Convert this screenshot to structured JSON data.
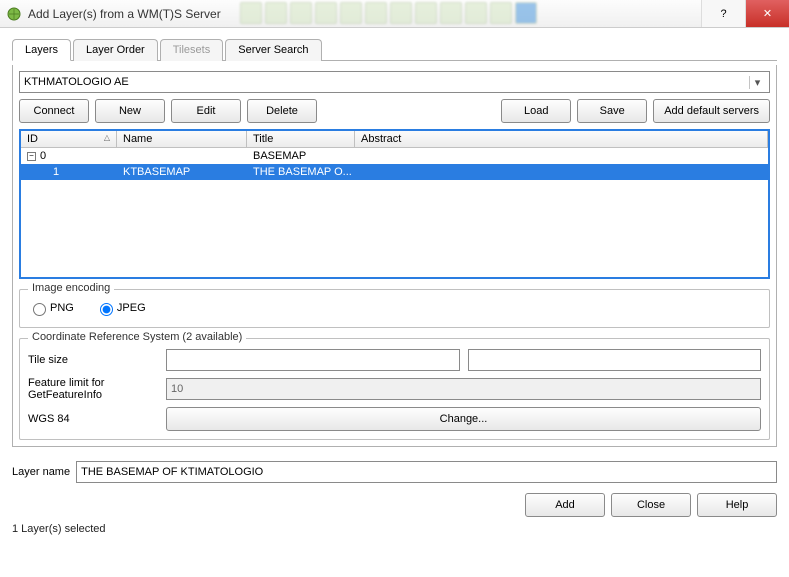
{
  "window": {
    "title": "Add Layer(s) from a WM(T)S Server"
  },
  "tabs": {
    "items": [
      {
        "label": "Layers",
        "active": true,
        "disabled": false
      },
      {
        "label": "Layer Order",
        "active": false,
        "disabled": false
      },
      {
        "label": "Tilesets",
        "active": false,
        "disabled": true
      },
      {
        "label": "Server Search",
        "active": false,
        "disabled": false
      }
    ]
  },
  "server_combo": {
    "value": "KTHMATOLOGIO AE"
  },
  "buttons": {
    "connect": "Connect",
    "new": "New",
    "edit": "Edit",
    "delete": "Delete",
    "load": "Load",
    "save": "Save",
    "add_defaults": "Add default servers",
    "change": "Change...",
    "add": "Add",
    "close": "Close",
    "help": "Help"
  },
  "table": {
    "headers": {
      "id": "ID",
      "name": "Name",
      "title": "Title",
      "abstract": "Abstract"
    },
    "rows": [
      {
        "level": 0,
        "expandable": true,
        "expanded": true,
        "id": "0",
        "name": "",
        "title": "BASEMAP",
        "abstract": "",
        "selected": false
      },
      {
        "level": 1,
        "expandable": false,
        "expanded": false,
        "id": "1",
        "name": "KTBASEMAP",
        "title": "THE BASEMAP O...",
        "abstract": "",
        "selected": true
      }
    ]
  },
  "encoding": {
    "legend": "Image encoding",
    "options": [
      {
        "label": "PNG",
        "checked": false
      },
      {
        "label": "JPEG",
        "checked": true
      }
    ]
  },
  "crs": {
    "legend": "Coordinate Reference System (2 available)",
    "tile_size_label": "Tile size",
    "tile_size_value": "",
    "feature_limit_label": "Feature limit for GetFeatureInfo",
    "feature_limit_value": "10",
    "crs_label": "WGS 84"
  },
  "layer_name": {
    "label": "Layer name",
    "value": "THE BASEMAP OF KTIMATOLOGIO"
  },
  "status": "1 Layer(s) selected",
  "glyphs": {
    "help": "?",
    "close": "✕",
    "minus": "−",
    "dropdown": "▾",
    "sort": "△"
  }
}
